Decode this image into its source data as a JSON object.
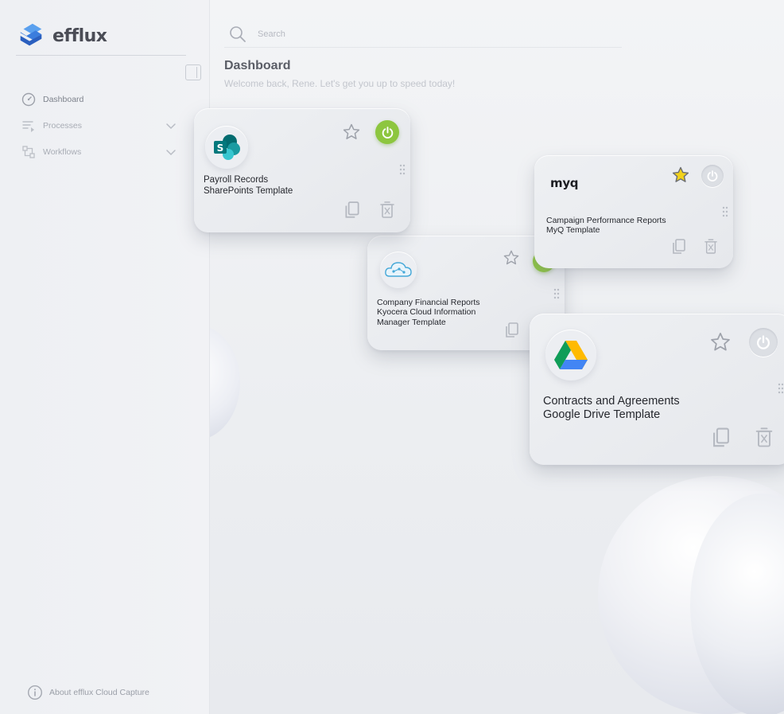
{
  "app": {
    "name": "efflux"
  },
  "search": {
    "placeholder": "Search"
  },
  "header": {
    "title": "Dashboard",
    "subtitle": "Welcome back, Rene. Let's get you up to speed today!"
  },
  "sidebar": {
    "items": [
      {
        "label": "Dashboard",
        "icon": "gauge-icon",
        "active": true
      },
      {
        "label": "Processes",
        "icon": "processes-icon",
        "expandable": true
      },
      {
        "label": "Workflows",
        "icon": "workflow-icon",
        "expandable": true
      }
    ],
    "about": "About efflux Cloud Capture"
  },
  "cards": [
    {
      "title_line1": "Payroll Records",
      "title_line2": "SharePoints Template",
      "title_line3": "",
      "icon": "sharepoint-icon",
      "starred": false,
      "power": "on"
    },
    {
      "title_line1": "Company Financial Reports",
      "title_line2": "Kyocera Cloud Information",
      "title_line3": "Manager Template",
      "icon": "kyocera-cloud-icon",
      "starred": false,
      "power": "on"
    },
    {
      "title_line1": "Campaign Performance Reports",
      "title_line2": "MyQ Template",
      "title_line3": "",
      "icon": "myq-logo",
      "logo_text": "myq",
      "starred": true,
      "power": "off"
    },
    {
      "title_line1": "Contracts and Agreements",
      "title_line2": "Google Drive Template",
      "title_line3": "",
      "icon": "google-drive-icon",
      "starred": false,
      "power": "off"
    }
  ],
  "colors": {
    "accent_blue": "#3b7ddd",
    "power_on": "#8dc63f",
    "star_active": "#f2d21b",
    "background": "#edeff2"
  }
}
